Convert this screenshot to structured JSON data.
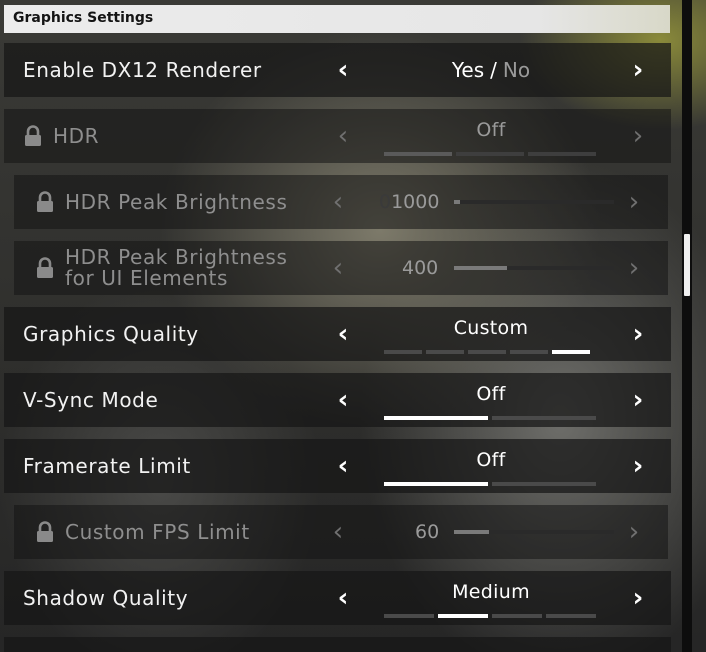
{
  "panel": {
    "title": "Graphics Settings"
  },
  "settings": {
    "dx12": {
      "label": "Enable DX12 Renderer",
      "yes": "Yes",
      "sep": "/",
      "no": "No",
      "selected": "Yes"
    },
    "hdr": {
      "label": "HDR",
      "value": "Off",
      "locked": true,
      "segments": 3,
      "selected_segment": 1
    },
    "hdr_peak": {
      "label": "HDR Peak Brightness",
      "value": "1000",
      "ghost_prefix": "0",
      "locked": true,
      "fill_fraction": 0.04
    },
    "hdr_peak_ui": {
      "label_line1": "HDR Peak Brightness",
      "label_line2": "for UI Elements",
      "value": "400",
      "locked": true,
      "fill_fraction": 0.33
    },
    "graphics_quality": {
      "label": "Graphics Quality",
      "value": "Custom",
      "segments": 5,
      "selected_segment": 5
    },
    "vsync": {
      "label": "V-Sync Mode",
      "value": "Off",
      "segments": 2,
      "selected_segment": 1
    },
    "framerate_limit": {
      "label": "Framerate Limit",
      "value": "Off",
      "segments": 2,
      "selected_segment": 1
    },
    "custom_fps": {
      "label": "Custom FPS Limit",
      "value": "60",
      "locked": true,
      "fill_fraction": 0.22
    },
    "shadow_quality": {
      "label": "Shadow Quality",
      "value": "Medium",
      "segments": 4,
      "selected_segment": 2
    }
  },
  "icons": {
    "left": "chevron-left-icon",
    "right": "chevron-right-icon",
    "lock": "lock-icon"
  },
  "colors": {
    "header_bg": "#ececec",
    "row_bg": "#161616",
    "active_segment": "#ffffff",
    "inactive_segment": "#4a4a4a",
    "locked_text": "#8e8e8e"
  }
}
